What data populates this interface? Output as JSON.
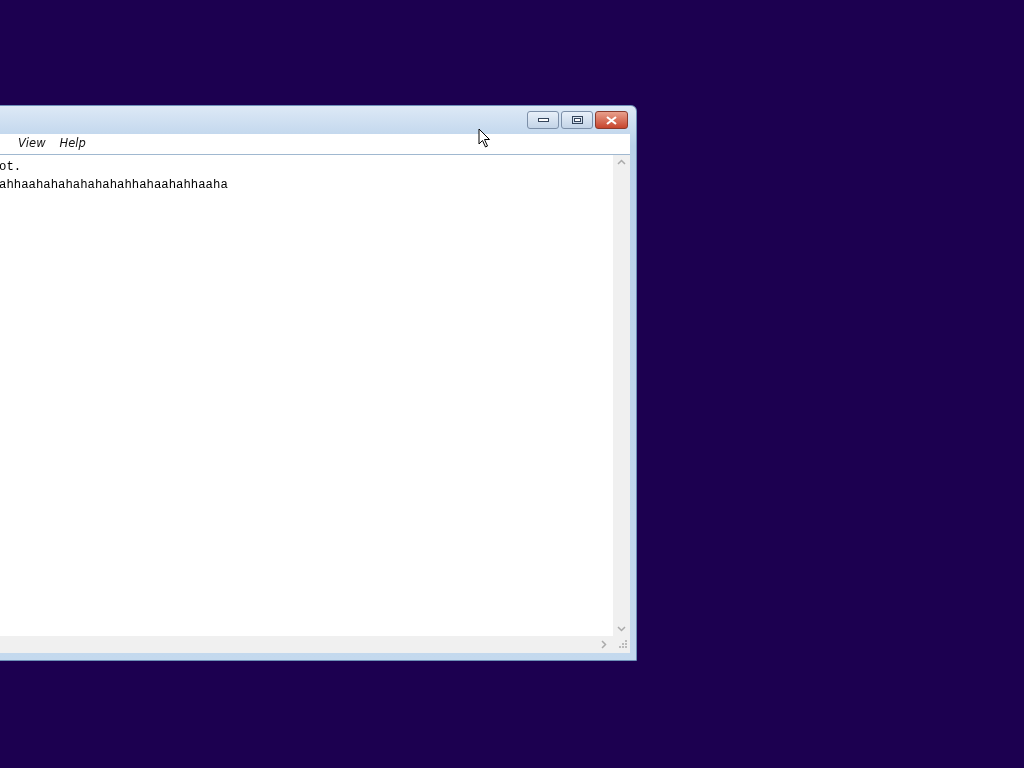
{
  "menu": [
    {
      "label": "View"
    },
    {
      "label": "Help"
    }
  ],
  "document": {
    "lines": [
      "ot.",
      "ahhaahahahahahahahhahaahahhaaha"
    ]
  }
}
